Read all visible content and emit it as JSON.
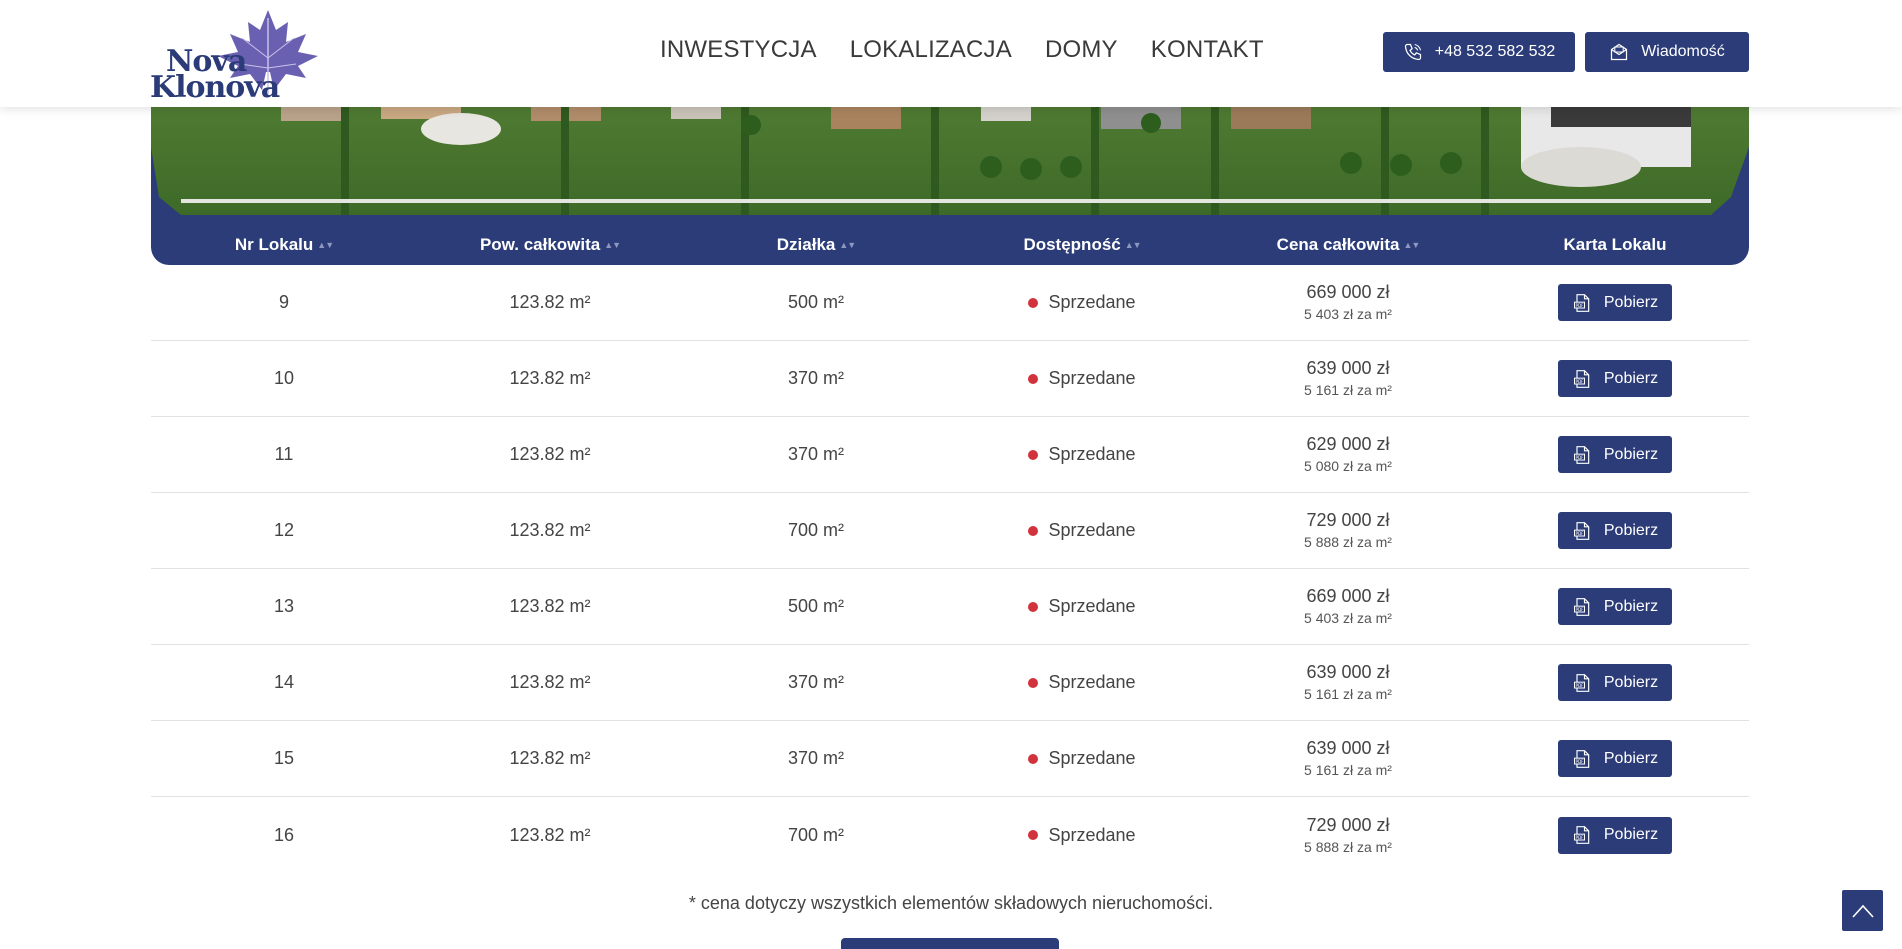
{
  "header": {
    "logo": {
      "line1": "Nova",
      "line2": "Klonova"
    },
    "nav": [
      "INWESTYCJA",
      "LOKALIZACJA",
      "DOMY",
      "KONTAKT"
    ],
    "phone_label": "+48 532 582 532",
    "message_label": "Wiadomość"
  },
  "table": {
    "columns": [
      "Nr Lokalu",
      "Pow. całkowita",
      "Działka",
      "Dostępność",
      "Cena całkowita",
      "Karta Lokalu"
    ],
    "sort_glyph": "▲▼",
    "download_label": "Pobierz",
    "rows": [
      {
        "nr": "9",
        "pow": "123.82 m²",
        "dzialka": "500 m²",
        "status": "Sprzedane",
        "price": "669 000 zł",
        "per_m2": "5 403 zł za m²"
      },
      {
        "nr": "10",
        "pow": "123.82 m²",
        "dzialka": "370 m²",
        "status": "Sprzedane",
        "price": "639 000 zł",
        "per_m2": "5 161 zł za m²"
      },
      {
        "nr": "11",
        "pow": "123.82 m²",
        "dzialka": "370 m²",
        "status": "Sprzedane",
        "price": "629 000 zł",
        "per_m2": "5 080 zł za m²"
      },
      {
        "nr": "12",
        "pow": "123.82 m²",
        "dzialka": "700 m²",
        "status": "Sprzedane",
        "price": "729 000 zł",
        "per_m2": "5 888 zł za m²"
      },
      {
        "nr": "13",
        "pow": "123.82 m²",
        "dzialka": "500 m²",
        "status": "Sprzedane",
        "price": "669 000 zł",
        "per_m2": "5 403 zł za m²"
      },
      {
        "nr": "14",
        "pow": "123.82 m²",
        "dzialka": "370 m²",
        "status": "Sprzedane",
        "price": "639 000 zł",
        "per_m2": "5 161 zł za m²"
      },
      {
        "nr": "15",
        "pow": "123.82 m²",
        "dzialka": "370 m²",
        "status": "Sprzedane",
        "price": "639 000 zł",
        "per_m2": "5 161 zł za m²"
      },
      {
        "nr": "16",
        "pow": "123.82 m²",
        "dzialka": "700 m²",
        "status": "Sprzedane",
        "price": "729 000 zł",
        "per_m2": "5 888 zł za m²"
      }
    ]
  },
  "footnote": "* cena dotyczy wszystkich elementów składowych nieruchomości.",
  "colors": {
    "brand": "#2b3c78",
    "sold": "#d2323c"
  },
  "icons": {
    "phone": "phone-icon",
    "message": "envelope-icon",
    "download": "pdf-file-icon",
    "scroll_top": "chevron-up-icon"
  }
}
